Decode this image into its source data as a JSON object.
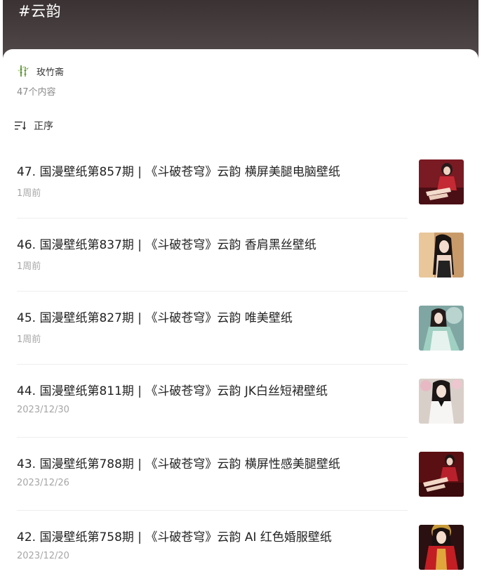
{
  "header": {
    "title": "#云韵"
  },
  "author": {
    "name": "玫竹斋",
    "icon": "bamboo-avatar-icon"
  },
  "collection": {
    "count_text": "47个内容"
  },
  "sort": {
    "label": "正序",
    "icon": "sort-icon"
  },
  "items": [
    {
      "title": "47. 国漫壁纸第857期 | 《斗破苍穹》云韵 横屏美腿电脑壁纸",
      "date": "1周前"
    },
    {
      "title": "46. 国漫壁纸第837期 | 《斗破苍穹》云韵 香肩黑丝壁纸",
      "date": "1周前"
    },
    {
      "title": "45. 国漫壁纸第827期 | 《斗破苍穹》云韵 唯美壁纸",
      "date": "1周前"
    },
    {
      "title": "44. 国漫壁纸第811期 | 《斗破苍穹》云韵 JK白丝短裙壁纸",
      "date": "2023/12/30"
    },
    {
      "title": "43. 国漫壁纸第788期 | 《斗破苍穹》云韵 横屏性感美腿壁纸",
      "date": "2023/12/26"
    },
    {
      "title": "42. 国漫壁纸第758期 | 《斗破苍穹》云韵 AI 红色婚服壁纸",
      "date": "2023/12/20"
    }
  ],
  "colors": {
    "header_bg": "#3a3233",
    "title_text": "#222222",
    "meta_text": "#a6a6a6",
    "divider": "#eeeeee"
  }
}
